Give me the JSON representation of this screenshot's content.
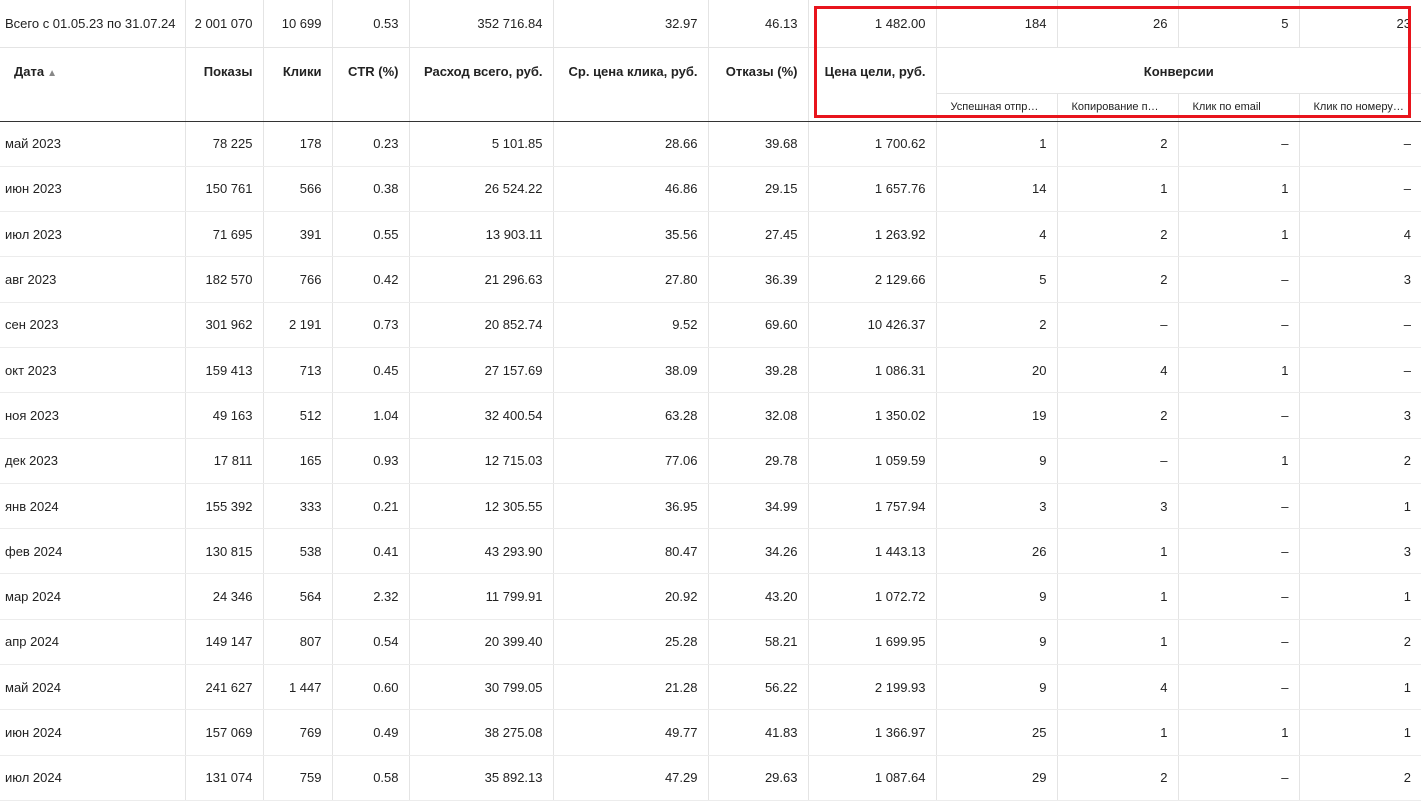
{
  "total_row": {
    "label": "Всего с 01.05.23 по 31.07.24",
    "values": [
      "2 001 070",
      "10 699",
      "0.53",
      "352 716.84",
      "32.97",
      "46.13",
      "1 482.00",
      "184",
      "26",
      "5",
      "23"
    ]
  },
  "headers": {
    "date": "Дата",
    "sort_icon": "▲",
    "columns": [
      "Показы",
      "Клики",
      "CTR (%)",
      "Расход всего, руб.",
      "Ср. цена клика, руб.",
      "Отказы (%)",
      "Цена цели, руб."
    ],
    "group": "Конверсии",
    "sub_columns": [
      "Успешная отпр…",
      "Копирование п…",
      "Клик по email",
      "Клик по номеру…"
    ]
  },
  "rows": [
    {
      "date": "май 2023",
      "values": [
        "78 225",
        "178",
        "0.23",
        "5 101.85",
        "28.66",
        "39.68",
        "1 700.62",
        "1",
        "2",
        "–",
        "–"
      ]
    },
    {
      "date": "июн 2023",
      "values": [
        "150 761",
        "566",
        "0.38",
        "26 524.22",
        "46.86",
        "29.15",
        "1 657.76",
        "14",
        "1",
        "1",
        "–"
      ]
    },
    {
      "date": "июл 2023",
      "values": [
        "71 695",
        "391",
        "0.55",
        "13 903.11",
        "35.56",
        "27.45",
        "1 263.92",
        "4",
        "2",
        "1",
        "4"
      ]
    },
    {
      "date": "авг 2023",
      "values": [
        "182 570",
        "766",
        "0.42",
        "21 296.63",
        "27.80",
        "36.39",
        "2 129.66",
        "5",
        "2",
        "–",
        "3"
      ]
    },
    {
      "date": "сен 2023",
      "values": [
        "301 962",
        "2 191",
        "0.73",
        "20 852.74",
        "9.52",
        "69.60",
        "10 426.37",
        "2",
        "–",
        "–",
        "–"
      ]
    },
    {
      "date": "окт 2023",
      "values": [
        "159 413",
        "713",
        "0.45",
        "27 157.69",
        "38.09",
        "39.28",
        "1 086.31",
        "20",
        "4",
        "1",
        "–"
      ]
    },
    {
      "date": "ноя 2023",
      "values": [
        "49 163",
        "512",
        "1.04",
        "32 400.54",
        "63.28",
        "32.08",
        "1 350.02",
        "19",
        "2",
        "–",
        "3"
      ]
    },
    {
      "date": "дек 2023",
      "values": [
        "17 811",
        "165",
        "0.93",
        "12 715.03",
        "77.06",
        "29.78",
        "1 059.59",
        "9",
        "–",
        "1",
        "2"
      ]
    },
    {
      "date": "янв 2024",
      "values": [
        "155 392",
        "333",
        "0.21",
        "12 305.55",
        "36.95",
        "34.99",
        "1 757.94",
        "3",
        "3",
        "–",
        "1"
      ]
    },
    {
      "date": "фев 2024",
      "values": [
        "130 815",
        "538",
        "0.41",
        "43 293.90",
        "80.47",
        "34.26",
        "1 443.13",
        "26",
        "1",
        "–",
        "3"
      ]
    },
    {
      "date": "мар 2024",
      "values": [
        "24 346",
        "564",
        "2.32",
        "11 799.91",
        "20.92",
        "43.20",
        "1 072.72",
        "9",
        "1",
        "–",
        "1"
      ]
    },
    {
      "date": "апр 2024",
      "values": [
        "149 147",
        "807",
        "0.54",
        "20 399.40",
        "25.28",
        "58.21",
        "1 699.95",
        "9",
        "1",
        "–",
        "2"
      ]
    },
    {
      "date": "май 2024",
      "values": [
        "241 627",
        "1 447",
        "0.60",
        "30 799.05",
        "21.28",
        "56.22",
        "2 199.93",
        "9",
        "4",
        "–",
        "1"
      ]
    },
    {
      "date": "июн 2024",
      "values": [
        "157 069",
        "769",
        "0.49",
        "38 275.08",
        "49.77",
        "41.83",
        "1 366.97",
        "25",
        "1",
        "1",
        "1"
      ]
    },
    {
      "date": "июл 2024",
      "values": [
        "131 074",
        "759",
        "0.58",
        "35 892.13",
        "47.29",
        "29.63",
        "1 087.64",
        "29",
        "2",
        "–",
        "2"
      ]
    }
  ],
  "highlight_color": "#e8141c"
}
